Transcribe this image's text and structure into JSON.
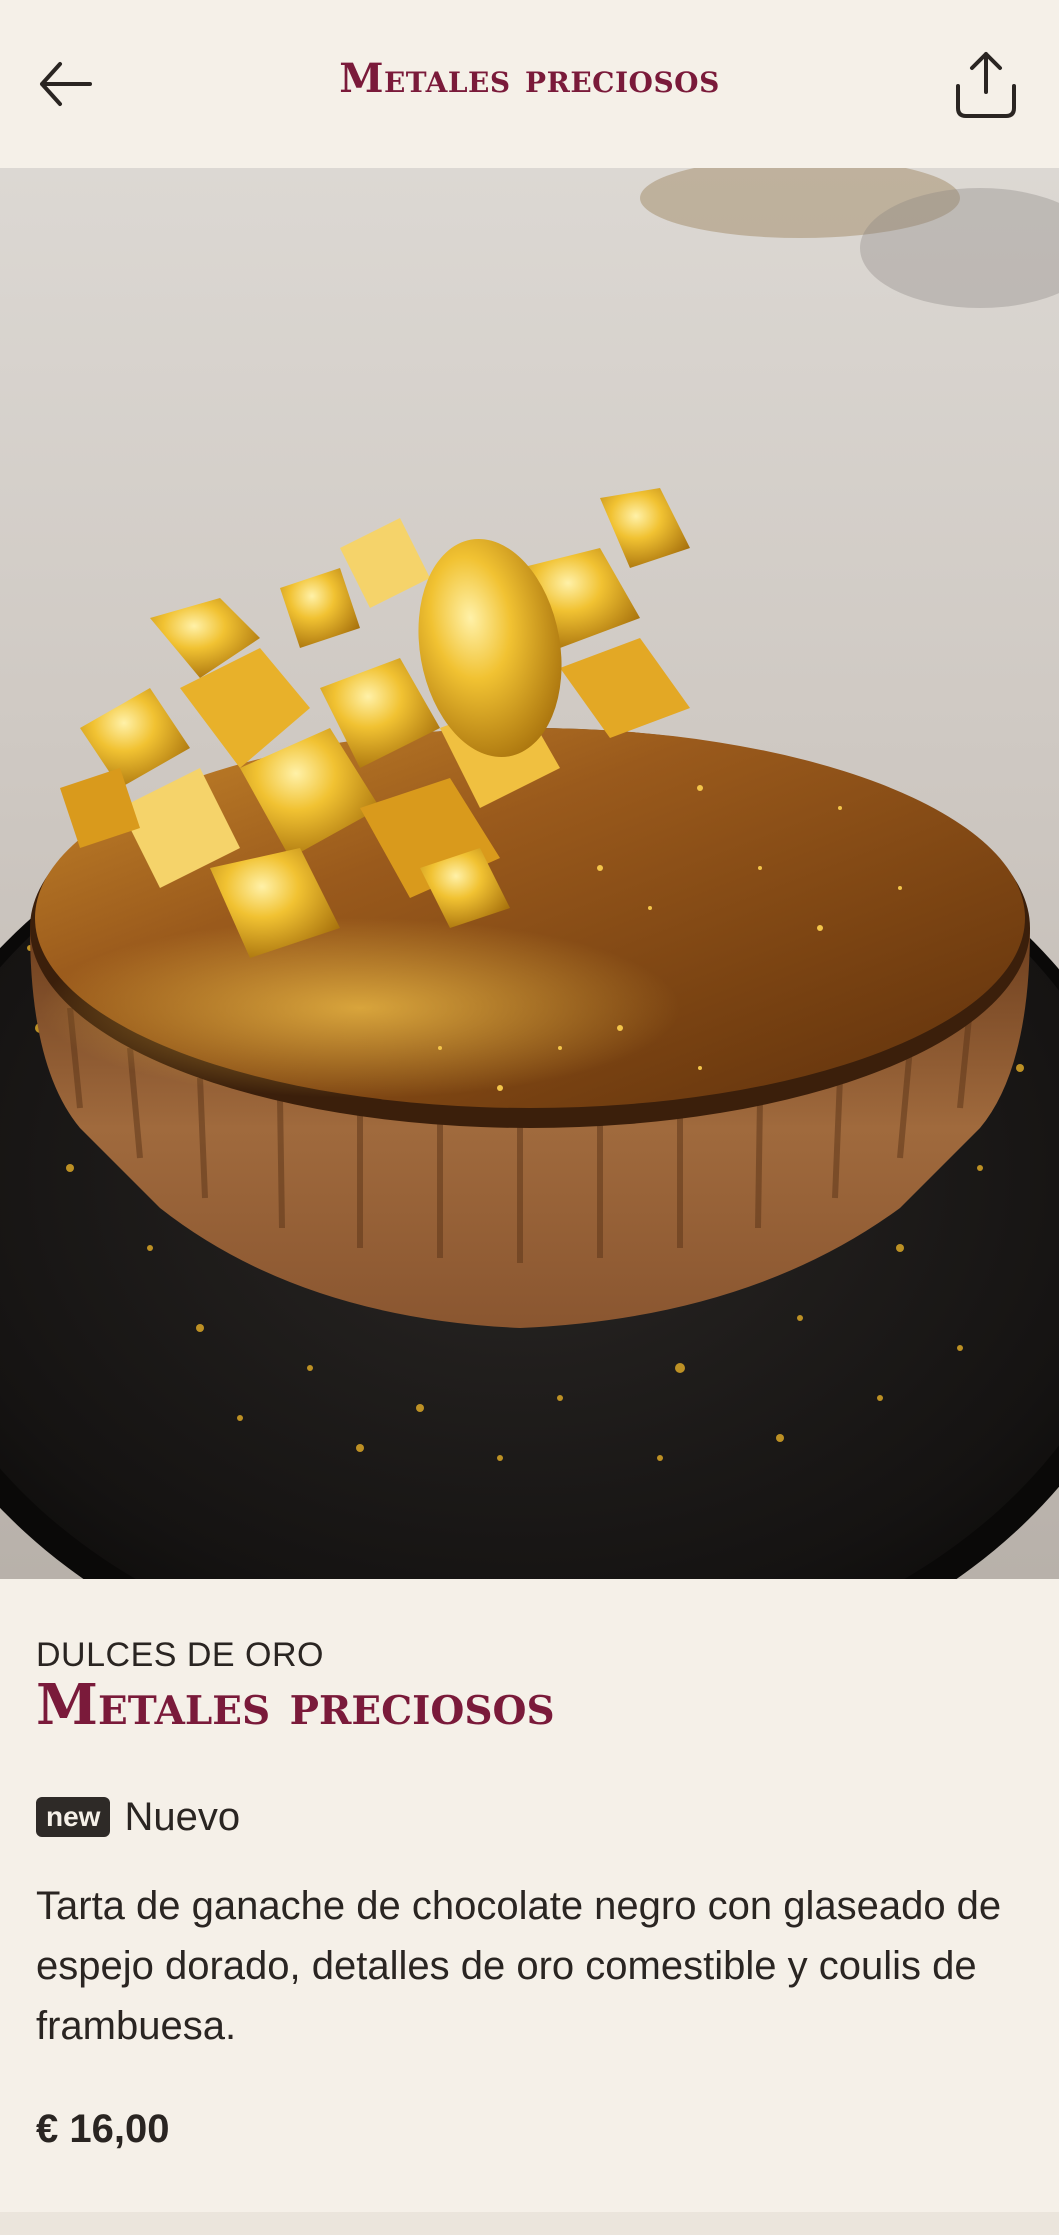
{
  "header": {
    "title": "Metales preciosos",
    "back_icon": "arrow-left-icon",
    "share_icon": "share-upload-icon"
  },
  "hero": {
    "image_icon": "gold-chocolate-tart-photo"
  },
  "product": {
    "category": "DULCES DE ORO",
    "title": "Metales preciosos",
    "badge": "new",
    "badge_label": "Nuevo",
    "description": "Tarta de ganache de chocolate negro con glaseado de espejo dorado, detalles de oro comestible y coulis de frambuesa.",
    "price": "€ 16,00"
  },
  "colors": {
    "background": "#f5f0e8",
    "accent": "#7a1a3a",
    "text": "#2a2522",
    "badge_bg": "#2e2a27"
  }
}
